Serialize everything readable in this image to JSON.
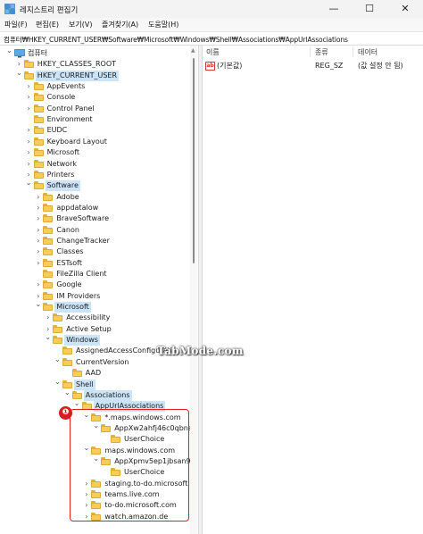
{
  "window": {
    "title": "레지스트리 편집기",
    "controls": {
      "minimize": "—",
      "maximize": "☐",
      "close": "✕"
    }
  },
  "menu": [
    "파일(F)",
    "편집(E)",
    "보기(V)",
    "즐겨찾기(A)",
    "도움말(H)"
  ],
  "address": "컴퓨터₩HKEY_CURRENT_USER₩Software₩Microsoft₩Windows₩Shell₩Associations₩AppUrlAssociations",
  "tree": [
    {
      "label": "컴퓨터",
      "depth": 0,
      "expanded": true,
      "icon": "computer-icon"
    },
    {
      "label": "HKEY_CLASSES_ROOT",
      "depth": 1,
      "expanded": false
    },
    {
      "label": "HKEY_CURRENT_USER",
      "depth": 1,
      "expanded": true,
      "highlight": true
    },
    {
      "label": "AppEvents",
      "depth": 2,
      "expanded": false
    },
    {
      "label": "Console",
      "depth": 2,
      "expanded": false
    },
    {
      "label": "Control Panel",
      "depth": 2,
      "expanded": false
    },
    {
      "label": "Environment",
      "depth": 2,
      "expanded": null
    },
    {
      "label": "EUDC",
      "depth": 2,
      "expanded": false
    },
    {
      "label": "Keyboard Layout",
      "depth": 2,
      "expanded": false
    },
    {
      "label": "Microsoft",
      "depth": 2,
      "expanded": false
    },
    {
      "label": "Network",
      "depth": 2,
      "expanded": false
    },
    {
      "label": "Printers",
      "depth": 2,
      "expanded": false
    },
    {
      "label": "Software",
      "depth": 2,
      "expanded": true,
      "highlight": true
    },
    {
      "label": "Adobe",
      "depth": 3,
      "expanded": false
    },
    {
      "label": "appdatalow",
      "depth": 3,
      "expanded": false
    },
    {
      "label": "BraveSoftware",
      "depth": 3,
      "expanded": false
    },
    {
      "label": "Canon",
      "depth": 3,
      "expanded": false
    },
    {
      "label": "ChangeTracker",
      "depth": 3,
      "expanded": false
    },
    {
      "label": "Classes",
      "depth": 3,
      "expanded": false
    },
    {
      "label": "ESTsoft",
      "depth": 3,
      "expanded": false
    },
    {
      "label": "FileZilla Client",
      "depth": 3,
      "expanded": null
    },
    {
      "label": "Google",
      "depth": 3,
      "expanded": false
    },
    {
      "label": "IM Providers",
      "depth": 3,
      "expanded": false
    },
    {
      "label": "Microsoft",
      "depth": 3,
      "expanded": true,
      "highlight": true
    },
    {
      "label": "Accessibility",
      "depth": 4,
      "expanded": false
    },
    {
      "label": "Active Setup",
      "depth": 4,
      "expanded": false
    },
    {
      "label": "Windows",
      "depth": 4,
      "expanded": true,
      "highlight": true
    },
    {
      "label": "AssignedAccessConfiguratio",
      "depth": 5,
      "expanded": null
    },
    {
      "label": "CurrentVersion",
      "depth": 5,
      "expanded": true
    },
    {
      "label": "AAD",
      "depth": 6,
      "expanded": null
    },
    {
      "label": "Shell",
      "depth": 5,
      "expanded": true,
      "highlight": true
    },
    {
      "label": "Associations",
      "depth": 6,
      "expanded": true,
      "highlight": true
    },
    {
      "label": "AppUrlAssociations",
      "depth": 7,
      "expanded": true,
      "highlight": true
    },
    {
      "label": "*.maps.windows.com",
      "depth": 8,
      "expanded": true
    },
    {
      "label": "AppXw2ahfj46c0qbns7",
      "depth": 9,
      "expanded": true
    },
    {
      "label": "UserChoice",
      "depth": 10,
      "expanded": null
    },
    {
      "label": "maps.windows.com",
      "depth": 8,
      "expanded": true
    },
    {
      "label": "AppXpmv5ep1jbsan9p",
      "depth": 9,
      "expanded": true
    },
    {
      "label": "UserChoice",
      "depth": 10,
      "expanded": null
    },
    {
      "label": "staging.to-do.microsoft.c",
      "depth": 8,
      "expanded": false
    },
    {
      "label": "teams.live.com",
      "depth": 8,
      "expanded": false
    },
    {
      "label": "to-do.microsoft.com",
      "depth": 8,
      "expanded": false
    },
    {
      "label": "watch.amazon.de",
      "depth": 8,
      "expanded": false
    }
  ],
  "list": {
    "columns": [
      "이름",
      "종류",
      "데이터"
    ],
    "rows": [
      {
        "name": "(기본값)",
        "type": "REG_SZ",
        "data": "(값 설정 안 됨)",
        "icon": "string-value-icon"
      }
    ]
  },
  "annotation": {
    "marker": "❶",
    "color": "#e02020"
  },
  "watermark": "TabMode.com",
  "colors": {
    "highlight": "#cce4f7",
    "folder": "#f7cd57"
  }
}
